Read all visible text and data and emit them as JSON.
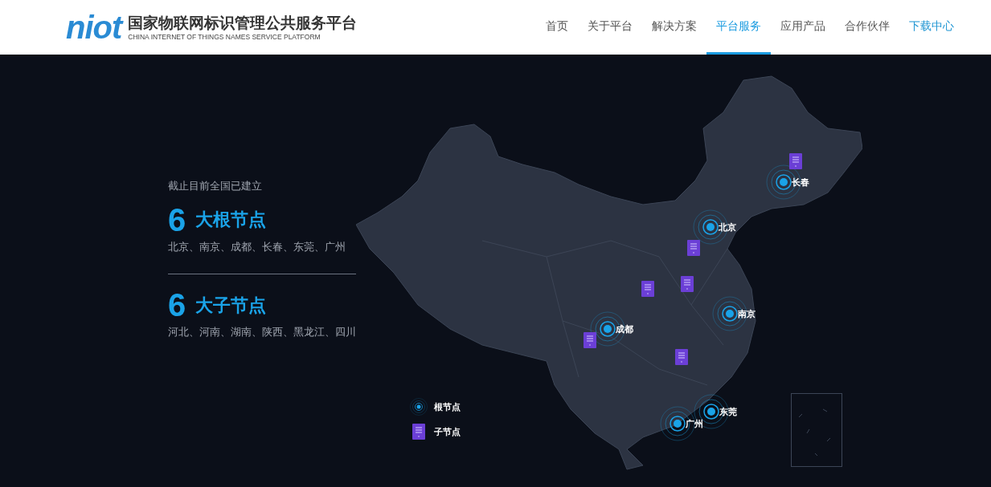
{
  "header": {
    "logo_mark": "niot",
    "logo_title": "国家物联网标识管理公共服务平台",
    "logo_subtitle": "CHINA INTERNET OF THINGS NAMES SERVICE PLATFORM"
  },
  "nav": [
    {
      "label": "首页",
      "selected": false,
      "accent": false
    },
    {
      "label": "关于平台",
      "selected": false,
      "accent": false
    },
    {
      "label": "解决方案",
      "selected": false,
      "accent": false
    },
    {
      "label": "平台服务",
      "selected": true,
      "accent": false
    },
    {
      "label": "应用产品",
      "selected": false,
      "accent": false
    },
    {
      "label": "合作伙伴",
      "selected": false,
      "accent": false
    },
    {
      "label": "下载中心",
      "selected": false,
      "accent": true
    }
  ],
  "summary": {
    "intro": "截止目前全国已建立",
    "groups": [
      {
        "count": "6",
        "title": "大根节点",
        "cities": "北京、南京、成都、长春、东莞、广州"
      },
      {
        "count": "6",
        "title": "大子节点",
        "cities": "河北、河南、湖南、陕西、黑龙江、四川"
      }
    ]
  },
  "map": {
    "nodes": [
      {
        "kind": "root",
        "label": "长春"
      },
      {
        "kind": "root",
        "label": "北京"
      },
      {
        "kind": "root",
        "label": "南京"
      },
      {
        "kind": "root",
        "label": "成都"
      },
      {
        "kind": "root",
        "label": "东莞"
      },
      {
        "kind": "root",
        "label": "广州"
      },
      {
        "kind": "sub"
      },
      {
        "kind": "sub"
      },
      {
        "kind": "sub"
      },
      {
        "kind": "sub"
      },
      {
        "kind": "sub"
      },
      {
        "kind": "sub"
      }
    ],
    "legend": [
      {
        "kind": "root",
        "label": "根节点"
      },
      {
        "kind": "sub",
        "label": "子节点"
      }
    ]
  }
}
